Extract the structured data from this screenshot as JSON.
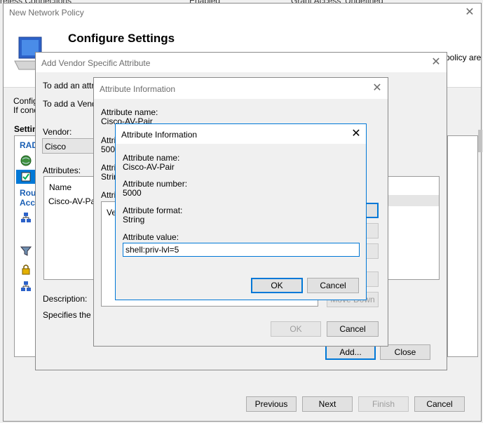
{
  "background": {
    "row1_col1": "reless Connections",
    "row1_col2": "Enabled",
    "row1_col3": "Grant Access",
    "row1_col4": "Undefined"
  },
  "policy_window": {
    "title": "New Network Policy",
    "header": "Configure Settings",
    "side_text_right": "policy are",
    "config_text_1": "Configu",
    "config_text_2": "If condi",
    "settings_label": "Settin",
    "left_nav": {
      "radius_label": "RAD",
      "routing_label_1": "Rou",
      "routing_label_2": "Acce"
    },
    "buttons": {
      "previous": "Previous",
      "next": "Next",
      "finish": "Finish",
      "cancel": "Cancel"
    }
  },
  "vsa_window": {
    "title": "Add Vendor Specific Attribute",
    "intro_1": "To add an attrib",
    "intro_2": "To add a Vendo",
    "vendor_label": "Vendor:",
    "vendor_value": "Cisco",
    "attributes_label": "Attributes:",
    "list_header": "Name",
    "list_item": "Cisco-AV-Pair",
    "description_label": "Description:",
    "description_text": "Specifies the Ci",
    "buttons": {
      "add": "Add...",
      "close": "Close"
    }
  },
  "attr_info_back": {
    "title": "Attribute Information",
    "name_label": "Attribute name:",
    "name_value": "Cisco-AV-Pair",
    "number_label_partial": "Attrib",
    "number_value_partial": "5000",
    "format_label_partial": "Attrib",
    "format_value_partial": "Strin",
    "value_label_partial": "Attrib",
    "values_header_partial": "Ven",
    "move_down": "Move Down",
    "buttons": {
      "ok": "OK",
      "cancel": "Cancel"
    }
  },
  "attr_info_front": {
    "title": "Attribute Information",
    "name_label": "Attribute name:",
    "name_value": "Cisco-AV-Pair",
    "number_label": "Attribute number:",
    "number_value": "5000",
    "format_label": "Attribute format:",
    "format_value": "String",
    "value_label": "Attribute value:",
    "value_input": "shell:priv-lvl=5",
    "buttons": {
      "ok": "OK",
      "cancel": "Cancel"
    }
  },
  "colors": {
    "accent": "#0078d7",
    "header_link": "#1a5fb4"
  }
}
